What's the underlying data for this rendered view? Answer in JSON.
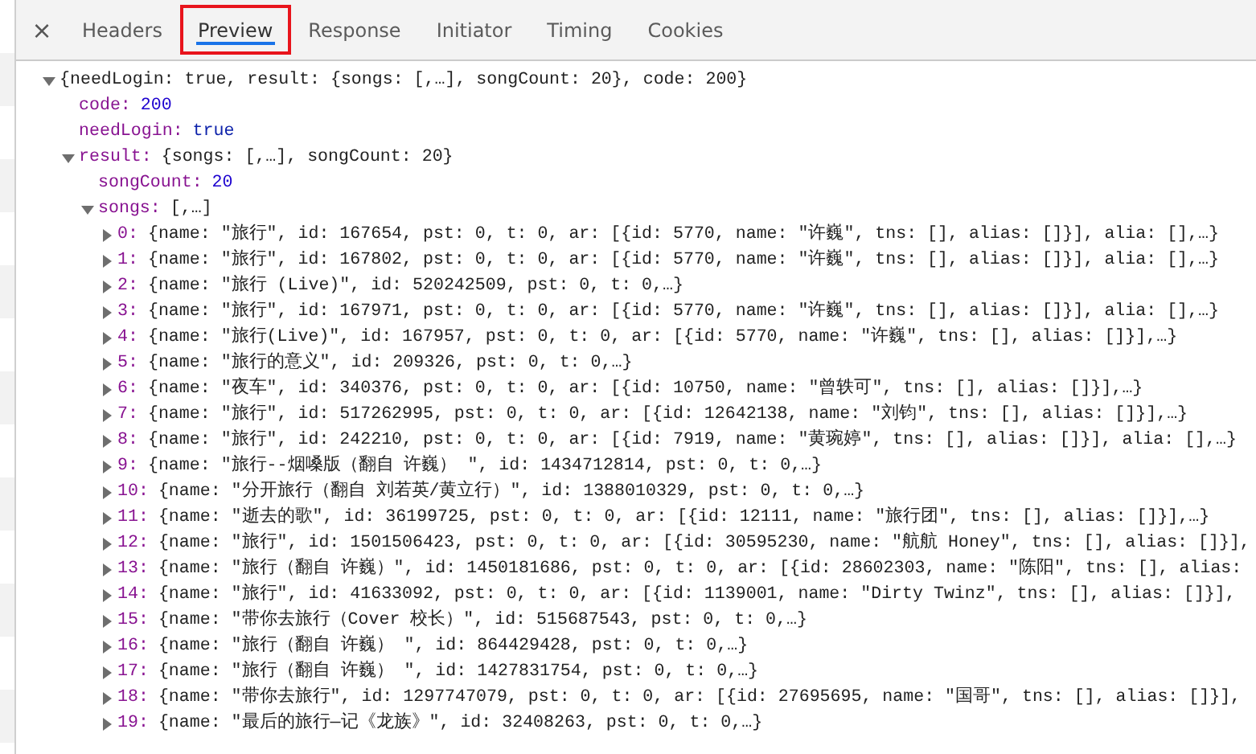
{
  "close_label": "×",
  "tabs": [
    {
      "label": "Headers",
      "selected": false,
      "highlighted": false
    },
    {
      "label": "Preview",
      "selected": true,
      "highlighted": true
    },
    {
      "label": "Response",
      "selected": false,
      "highlighted": false
    },
    {
      "label": "Initiator",
      "selected": false,
      "highlighted": false
    },
    {
      "label": "Timing",
      "selected": false,
      "highlighted": false
    },
    {
      "label": "Cookies",
      "selected": false,
      "highlighted": false
    }
  ],
  "tree": {
    "kind": "object",
    "summary": "{needLogin: true, result: {songs: [,…], songCount: 20}, code: 200}",
    "expanded": true,
    "children": [
      {
        "kind": "number",
        "key": "code:",
        "value": "200"
      },
      {
        "kind": "boolean",
        "key": "needLogin:",
        "value": "true"
      },
      {
        "kind": "object",
        "key": "result:",
        "summary": "{songs: [,…], songCount: 20}",
        "expanded": true,
        "children": [
          {
            "kind": "number",
            "key": "songCount:",
            "value": "20"
          },
          {
            "kind": "object",
            "key": "songs:",
            "summary": "[,…]",
            "expanded": true,
            "children": [
              {
                "kind": "object",
                "key": "0:",
                "summary": "{name: \"旅行\", id: 167654, pst: 0, t: 0, ar: [{id: 5770, name: \"许巍\", tns: [], alias: []}], alia: [],…}",
                "expanded": false
              },
              {
                "kind": "object",
                "key": "1:",
                "summary": "{name: \"旅行\", id: 167802, pst: 0, t: 0, ar: [{id: 5770, name: \"许巍\", tns: [], alias: []}], alia: [],…}",
                "expanded": false
              },
              {
                "kind": "object",
                "key": "2:",
                "summary": "{name: \"旅行 (Live)\", id: 520242509, pst: 0, t: 0,…}",
                "expanded": false
              },
              {
                "kind": "object",
                "key": "3:",
                "summary": "{name: \"旅行\", id: 167971, pst: 0, t: 0, ar: [{id: 5770, name: \"许巍\", tns: [], alias: []}], alia: [],…}",
                "expanded": false
              },
              {
                "kind": "object",
                "key": "4:",
                "summary": "{name: \"旅行(Live)\", id: 167957, pst: 0, t: 0, ar: [{id: 5770, name: \"许巍\", tns: [], alias: []}],…}",
                "expanded": false
              },
              {
                "kind": "object",
                "key": "5:",
                "summary": "{name: \"旅行的意义\", id: 209326, pst: 0, t: 0,…}",
                "expanded": false
              },
              {
                "kind": "object",
                "key": "6:",
                "summary": "{name: \"夜车\", id: 340376, pst: 0, t: 0, ar: [{id: 10750, name: \"曾轶可\", tns: [], alias: []}],…}",
                "expanded": false
              },
              {
                "kind": "object",
                "key": "7:",
                "summary": "{name: \"旅行\", id: 517262995, pst: 0, t: 0, ar: [{id: 12642138, name: \"刘钧\", tns: [], alias: []}],…}",
                "expanded": false
              },
              {
                "kind": "object",
                "key": "8:",
                "summary": "{name: \"旅行\", id: 242210, pst: 0, t: 0, ar: [{id: 7919, name: \"黄琬婷\", tns: [], alias: []}], alia: [],…}",
                "expanded": false
              },
              {
                "kind": "object",
                "key": "9:",
                "summary": "{name: \"旅行--烟嗓版（翻自 许巍） \", id: 1434712814, pst: 0, t: 0,…}",
                "expanded": false
              },
              {
                "kind": "object",
                "key": "10:",
                "summary": "{name: \"分开旅行（翻自 刘若英/黄立行）\", id: 1388010329, pst: 0, t: 0,…}",
                "expanded": false
              },
              {
                "kind": "object",
                "key": "11:",
                "summary": "{name: \"逝去的歌\", id: 36199725, pst: 0, t: 0, ar: [{id: 12111, name: \"旅行团\", tns: [], alias: []}],…}",
                "expanded": false
              },
              {
                "kind": "object",
                "key": "12:",
                "summary": "{name: \"旅行\", id: 1501506423, pst: 0, t: 0, ar: [{id: 30595230, name: \"航航 Honey\", tns: [], alias: []}],",
                "expanded": false
              },
              {
                "kind": "object",
                "key": "13:",
                "summary": "{name: \"旅行（翻自 许巍）\", id: 1450181686, pst: 0, t: 0, ar: [{id: 28602303, name: \"陈阳\", tns: [], alias:",
                "expanded": false
              },
              {
                "kind": "object",
                "key": "14:",
                "summary": "{name: \"旅行\", id: 41633092, pst: 0, t: 0, ar: [{id: 1139001, name: \"Dirty Twinz\", tns: [], alias: []}],",
                "expanded": false
              },
              {
                "kind": "object",
                "key": "15:",
                "summary": "{name: \"带你去旅行（Cover 校长）\", id: 515687543, pst: 0, t: 0,…}",
                "expanded": false
              },
              {
                "kind": "object",
                "key": "16:",
                "summary": "{name: \"旅行（翻自 许巍） \", id: 864429428, pst: 0, t: 0,…}",
                "expanded": false
              },
              {
                "kind": "object",
                "key": "17:",
                "summary": "{name: \"旅行（翻自 许巍） \", id: 1427831754, pst: 0, t: 0,…}",
                "expanded": false
              },
              {
                "kind": "object",
                "key": "18:",
                "summary": "{name: \"带你去旅行\", id: 1297747079, pst: 0, t: 0, ar: [{id: 27695695, name: \"国哥\", tns: [], alias: []}],",
                "expanded": false
              },
              {
                "kind": "object",
                "key": "19:",
                "summary": "{name: \"最后的旅行—记《龙族》\", id: 32408263, pst: 0, t: 0,…}",
                "expanded": false
              }
            ]
          }
        ]
      }
    ]
  }
}
